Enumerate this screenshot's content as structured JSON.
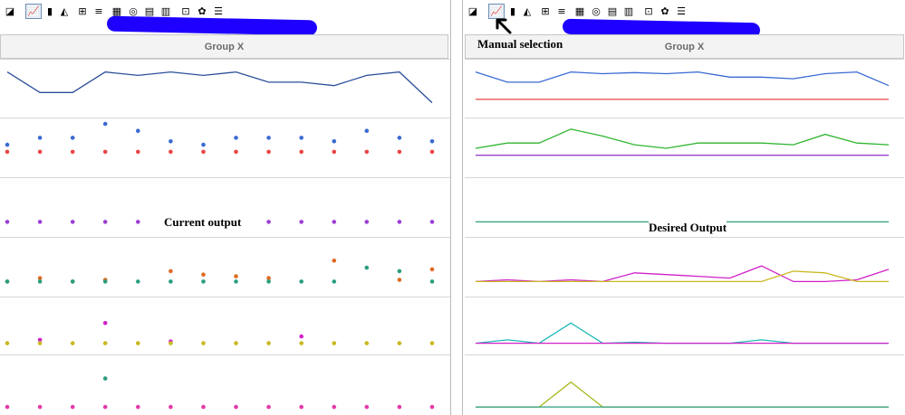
{
  "left": {
    "group_header": "Group X",
    "caption": "Current output"
  },
  "right": {
    "group_header": "Group X",
    "annotation": "Manual selection",
    "caption": "Desired Output"
  },
  "toolbar": {
    "buttons": [
      {
        "name": "scatter-plot-icon",
        "glyph": "◪"
      },
      {
        "name": "line-chart-icon",
        "glyph": "📈"
      },
      {
        "name": "bar-chart-icon",
        "glyph": "▮"
      },
      {
        "name": "area-chart-icon",
        "glyph": "◭"
      },
      {
        "name": "boxplot-icon",
        "glyph": "⊞"
      },
      {
        "name": "text-list-icon",
        "glyph": "≡"
      },
      {
        "name": "grid-chart-icon",
        "glyph": "▦"
      },
      {
        "name": "pie-globe-icon",
        "glyph": "◎"
      },
      {
        "name": "table-icon",
        "glyph": "▤"
      },
      {
        "name": "settings-table-icon",
        "glyph": "▥"
      },
      {
        "name": "data-window-icon",
        "glyph": "⊡"
      },
      {
        "name": "decorative-chart-icon",
        "glyph": "✿"
      },
      {
        "name": "properties-icon",
        "glyph": "☰"
      }
    ]
  },
  "colors": {
    "blue": "#3a6ad2",
    "navy": "#2b4f9a",
    "red": "#e84545",
    "green": "#2fb52f",
    "purple": "#9b3fd4",
    "magenta": "#d020c8",
    "teal": "#2a9e7e",
    "orange": "#e06a22",
    "yellow": "#c9b820",
    "olive": "#a8b81c",
    "cyan": "#20b8b8",
    "pink": "#e33aa8"
  },
  "chart_data": [
    {
      "type": "scatter",
      "title": "Current output",
      "x": [
        1,
        2,
        3,
        4,
        5,
        6,
        7,
        8,
        9,
        10,
        11,
        12,
        13,
        14
      ],
      "panes": [
        {
          "series": [
            {
              "mark": "line",
              "color": "navy",
              "values": [
                12,
                6,
                6,
                12,
                11,
                12,
                11,
                12,
                9,
                9,
                8,
                11,
                12,
                3
              ]
            }
          ]
        },
        {
          "series": [
            {
              "mark": "dot",
              "color": "blue",
              "values": [
                8,
                10,
                10,
                14,
                12,
                9,
                8,
                10,
                10,
                10,
                9,
                12,
                10,
                9
              ]
            },
            {
              "mark": "dot",
              "color": "red",
              "values": [
                6,
                6,
                6,
                6,
                6,
                6,
                6,
                6,
                6,
                6,
                6,
                6,
                6,
                6
              ]
            }
          ]
        },
        {
          "series": [
            {
              "mark": "dot",
              "color": "purple",
              "values": [
                3,
                3,
                3,
                3,
                3,
                3,
                3,
                3,
                3,
                3,
                3,
                3,
                3,
                3
              ]
            }
          ]
        },
        {
          "series": [
            {
              "mark": "dot",
              "color": "orange",
              "values": [
                3,
                4,
                3,
                3.5,
                null,
                6,
                5,
                4.5,
                4,
                null,
                9,
                null,
                3.5,
                6.5
              ]
            },
            {
              "mark": "dot",
              "color": "teal",
              "values": [
                3,
                3,
                3,
                3,
                3,
                3,
                3,
                3,
                3,
                3,
                3,
                7,
                6,
                3
              ]
            }
          ]
        },
        {
          "series": [
            {
              "mark": "dot",
              "color": "magenta",
              "values": [
                null,
                3,
                null,
                8,
                null,
                2.5,
                null,
                null,
                null,
                4,
                null,
                null,
                null,
                null
              ]
            },
            {
              "mark": "dot",
              "color": "yellow",
              "values": [
                2,
                2,
                2,
                2,
                2,
                2,
                2,
                2,
                2,
                2,
                2,
                2,
                2,
                2
              ]
            }
          ]
        },
        {
          "series": [
            {
              "mark": "dot",
              "color": "teal",
              "values": [
                null,
                null,
                null,
                9,
                null,
                null,
                null,
                null,
                null,
                null,
                null,
                null,
                null,
                null
              ]
            },
            {
              "mark": "dot",
              "color": "pink",
              "values": [
                1,
                1,
                1,
                1,
                1,
                1,
                1,
                1,
                1,
                1,
                1,
                1,
                1,
                1
              ]
            }
          ]
        }
      ]
    },
    {
      "type": "line",
      "title": "Desired Output",
      "x": [
        1,
        2,
        3,
        4,
        5,
        6,
        7,
        8,
        9,
        10,
        11,
        12,
        13,
        14
      ],
      "panes": [
        {
          "series": [
            {
              "color": "blue",
              "values": [
                12,
                9,
                9,
                12,
                11.5,
                11.8,
                11.5,
                12,
                10.5,
                10.5,
                10,
                11.5,
                12,
                8
              ]
            },
            {
              "color": "red",
              "values": [
                4,
                4,
                4,
                4,
                4,
                4,
                4,
                4,
                4,
                4,
                4,
                4,
                4,
                4
              ]
            }
          ]
        },
        {
          "series": [
            {
              "color": "green",
              "values": [
                7,
                8.5,
                8.5,
                12.5,
                10.5,
                8,
                7,
                8.5,
                8.5,
                8.5,
                8,
                11,
                8.5,
                8
              ]
            },
            {
              "color": "purple",
              "values": [
                5,
                5,
                5,
                5,
                5,
                5,
                5,
                5,
                5,
                5,
                5,
                5,
                5,
                5
              ]
            }
          ]
        },
        {
          "series": [
            {
              "color": "teal",
              "values": [
                3,
                3,
                3,
                3,
                3,
                3,
                3,
                3,
                3,
                3,
                3,
                3,
                3,
                3
              ]
            }
          ]
        },
        {
          "series": [
            {
              "color": "magenta",
              "values": [
                3,
                3.5,
                3,
                3.5,
                3,
                5.5,
                5,
                4.5,
                4,
                7.5,
                3,
                3,
                3.5,
                6.5
              ]
            },
            {
              "color": "yellow",
              "values": [
                3,
                3,
                3,
                3,
                3,
                3,
                3,
                3,
                3,
                3,
                6,
                5.5,
                3,
                3
              ]
            }
          ]
        },
        {
          "series": [
            {
              "color": "cyan",
              "values": [
                2,
                3,
                2,
                8,
                2,
                2.3,
                2,
                2,
                2,
                3,
                2,
                2,
                2,
                2
              ]
            },
            {
              "color": "magenta",
              "values": [
                2,
                2,
                2,
                2,
                2,
                2,
                2,
                2,
                2,
                2,
                2,
                2,
                2,
                2
              ]
            }
          ]
        },
        {
          "series": [
            {
              "color": "olive",
              "values": [
                1,
                1,
                1,
                8,
                1,
                1,
                1,
                1,
                1,
                1,
                1,
                1,
                1,
                1
              ]
            },
            {
              "color": "teal",
              "values": [
                1,
                1,
                1,
                1,
                1,
                1,
                1,
                1,
                1,
                1,
                1,
                1,
                1,
                1
              ]
            }
          ]
        }
      ]
    }
  ]
}
